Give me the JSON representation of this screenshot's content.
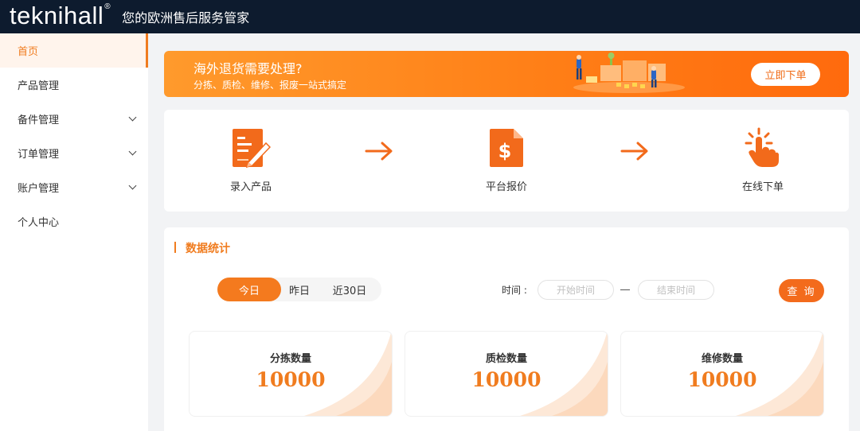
{
  "header": {
    "logo_text": "teknihall",
    "logo_mark": "®",
    "tagline": "您的欧洲售后服务管家"
  },
  "sidebar": {
    "items": [
      {
        "label": "首页",
        "active": true,
        "has_chevron": false
      },
      {
        "label": "产品管理",
        "active": false,
        "has_chevron": false
      },
      {
        "label": "备件管理",
        "active": false,
        "has_chevron": true
      },
      {
        "label": "订单管理",
        "active": false,
        "has_chevron": true
      },
      {
        "label": "账户管理",
        "active": false,
        "has_chevron": true
      },
      {
        "label": "个人中心",
        "active": false,
        "has_chevron": false
      }
    ]
  },
  "banner": {
    "title": "海外退货需要处理?",
    "subtitle": "分拣、质检、维修、报废一站式搞定",
    "button_label": "立即下单",
    "illustration_icon": "warehouse-workers-illustration"
  },
  "steps": [
    {
      "label": "录入产品",
      "icon": "edit-document-icon"
    },
    {
      "label": "平台报价",
      "icon": "dollar-document-icon"
    },
    {
      "label": "在线下单",
      "icon": "tap-hand-icon"
    }
  ],
  "stats": {
    "title": "数据统计",
    "range_tabs": [
      "今日",
      "昨日",
      "近30日"
    ],
    "active_tab": "今日",
    "time_label": "时间 :",
    "start_placeholder": "开始时间",
    "end_placeholder": "结束时间",
    "query_label": "查 询",
    "cards": [
      {
        "label": "分拣数量",
        "value": "10000"
      },
      {
        "label": "质检数量",
        "value": "10000"
      },
      {
        "label": "维修数量",
        "value": "10000"
      }
    ]
  },
  "colors": {
    "brand_orange": "#f07c1f",
    "header_bg": "#0d1b2e",
    "page_bg": "#f2f3f5"
  }
}
